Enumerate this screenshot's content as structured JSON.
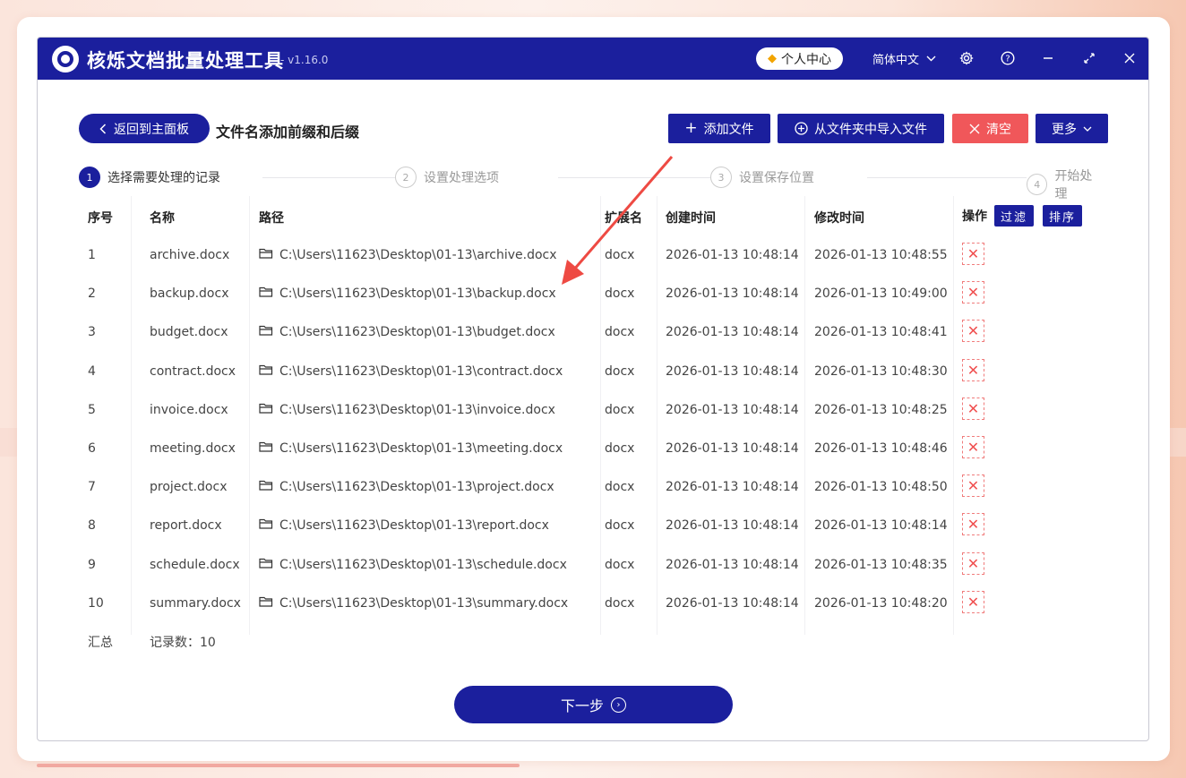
{
  "app": {
    "title": "核烁文档批量处理工具",
    "version": "- v1.16.0",
    "user_center": "个人中心",
    "language": "简体中文"
  },
  "toolbar": {
    "back_label": "返回到主面板",
    "page_title": "文件名添加前缀和后缀",
    "add_file": "添加文件",
    "import_folder": "从文件夹中导入文件",
    "clear": "清空",
    "more": "更多"
  },
  "steps": [
    {
      "num": "1",
      "label": "选择需要处理的记录"
    },
    {
      "num": "2",
      "label": "设置处理选项"
    },
    {
      "num": "3",
      "label": "设置保存位置"
    },
    {
      "num": "4",
      "label": "开始处理"
    }
  ],
  "table": {
    "headers": {
      "index": "序号",
      "name": "名称",
      "path": "路径",
      "ext": "扩展名",
      "created": "创建时间",
      "modified": "修改时间",
      "ops": "操作",
      "filter": "过滤",
      "sort": "排序"
    },
    "rows": [
      {
        "index": "1",
        "name": "archive.docx",
        "path": "C:\\Users\\11623\\Desktop\\01-13\\archive.docx",
        "ext": "docx",
        "created": "2026-01-13 10:48:14",
        "modified": "2026-01-13 10:48:55"
      },
      {
        "index": "2",
        "name": "backup.docx",
        "path": "C:\\Users\\11623\\Desktop\\01-13\\backup.docx",
        "ext": "docx",
        "created": "2026-01-13 10:48:14",
        "modified": "2026-01-13 10:49:00"
      },
      {
        "index": "3",
        "name": "budget.docx",
        "path": "C:\\Users\\11623\\Desktop\\01-13\\budget.docx",
        "ext": "docx",
        "created": "2026-01-13 10:48:14",
        "modified": "2026-01-13 10:48:41"
      },
      {
        "index": "4",
        "name": "contract.docx",
        "path": "C:\\Users\\11623\\Desktop\\01-13\\contract.docx",
        "ext": "docx",
        "created": "2026-01-13 10:48:14",
        "modified": "2026-01-13 10:48:30"
      },
      {
        "index": "5",
        "name": "invoice.docx",
        "path": "C:\\Users\\11623\\Desktop\\01-13\\invoice.docx",
        "ext": "docx",
        "created": "2026-01-13 10:48:14",
        "modified": "2026-01-13 10:48:25"
      },
      {
        "index": "6",
        "name": "meeting.docx",
        "path": "C:\\Users\\11623\\Desktop\\01-13\\meeting.docx",
        "ext": "docx",
        "created": "2026-01-13 10:48:14",
        "modified": "2026-01-13 10:48:46"
      },
      {
        "index": "7",
        "name": "project.docx",
        "path": "C:\\Users\\11623\\Desktop\\01-13\\project.docx",
        "ext": "docx",
        "created": "2026-01-13 10:48:14",
        "modified": "2026-01-13 10:48:50"
      },
      {
        "index": "8",
        "name": "report.docx",
        "path": "C:\\Users\\11623\\Desktop\\01-13\\report.docx",
        "ext": "docx",
        "created": "2026-01-13 10:48:14",
        "modified": "2026-01-13 10:48:14"
      },
      {
        "index": "9",
        "name": "schedule.docx",
        "path": "C:\\Users\\11623\\Desktop\\01-13\\schedule.docx",
        "ext": "docx",
        "created": "2026-01-13 10:48:14",
        "modified": "2026-01-13 10:48:35"
      },
      {
        "index": "10",
        "name": "summary.docx",
        "path": "C:\\Users\\11623\\Desktop\\01-13\\summary.docx",
        "ext": "docx",
        "created": "2026-01-13 10:48:14",
        "modified": "2026-01-13 10:48:20"
      }
    ],
    "summary_label": "汇总",
    "record_count": "记录数：10"
  },
  "footer": {
    "next_label": "下一步"
  },
  "colors": {
    "primary": "#1b1f9d",
    "danger": "#f0575a",
    "arrow": "#ee4a43"
  },
  "icons": [
    "logo-icon",
    "diamond-icon",
    "chevron-down-icon",
    "gear-icon",
    "help-icon",
    "minimize-icon",
    "expand-icon",
    "close-icon",
    "back-chevron-icon",
    "plus-icon",
    "plus-circle-icon",
    "x-icon",
    "folder-icon",
    "delete-icon",
    "next-circle-icon"
  ]
}
